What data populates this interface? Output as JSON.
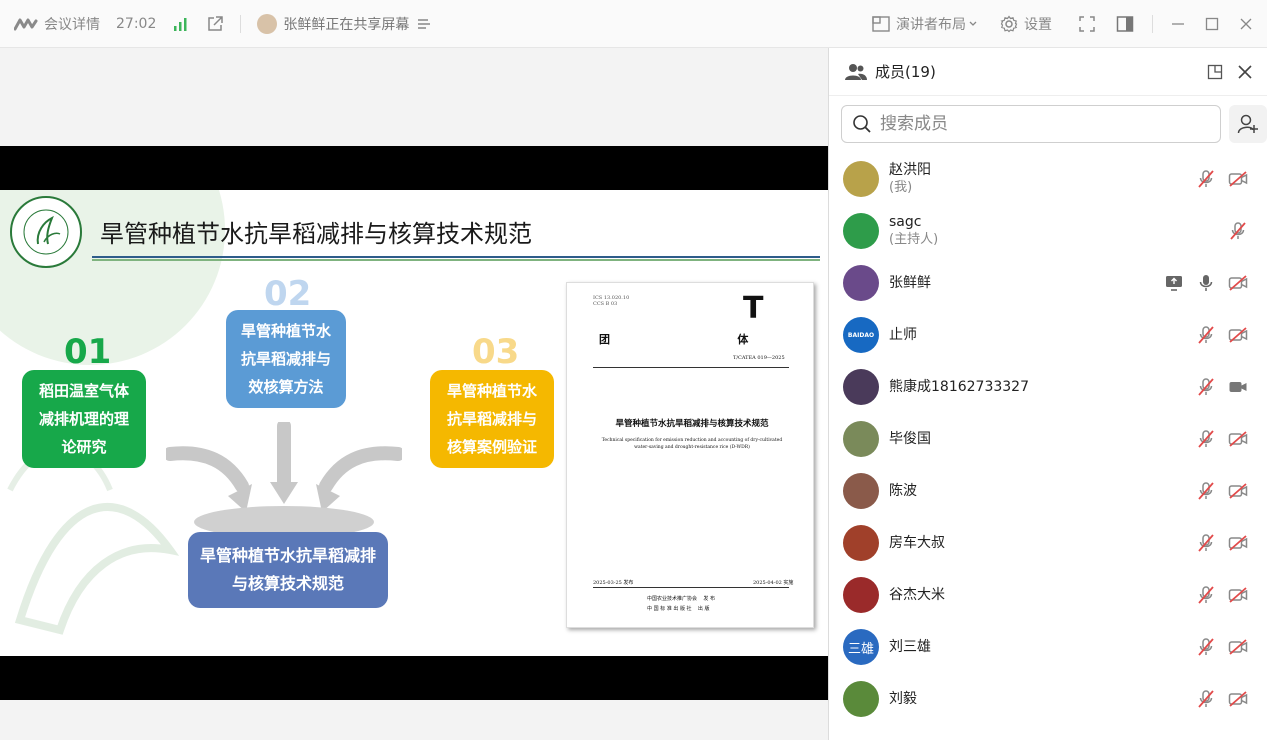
{
  "topbar": {
    "meeting_details": "会议详情",
    "timer": "27:02",
    "sharing_text": "张鲜鲜正在共享屏幕",
    "layout_label": "演讲者布局",
    "settings_label": "设置"
  },
  "slide": {
    "title": "旱管种植节水抗旱稻减排与核算技术规范",
    "items": [
      {
        "num": "01",
        "text": "稻田温室气体减排机理的理论研究"
      },
      {
        "num": "02",
        "text": "旱管种植节水抗旱稻减排与效核算方法"
      },
      {
        "num": "03",
        "text": "旱管种植节水抗旱稻减排与核算案例验证"
      }
    ],
    "center_box": "旱管种植节水抗旱稻减排与核算技术规范",
    "document": {
      "code": "ICS 13.020.10\nCCS B 03",
      "letter": "T",
      "heading": "团    体    标    准",
      "std_no": "T/CATEA  019—2025",
      "title_cn": "旱管种植节水抗旱稻减排与核算技术规范",
      "title_en": "Technical specification for emission reduction and accounting of dry-cultivated water-saving and drought-resistance rice (D-WDR)",
      "issue_date": "2025-03-25 发布",
      "impl_date": "2025-04-02 实施",
      "publisher1": "中国农业技术推广协会    发 布",
      "publisher2": "中 国 标 准 出 版 社    出 版"
    }
  },
  "panel": {
    "title": "成员(19)",
    "search_placeholder": "搜索成员",
    "members": [
      {
        "name": "赵洪阳",
        "role": "(我)",
        "avatar_color": "#b8a24a",
        "avatar_text": "",
        "share": false,
        "mic": "muted",
        "cam": "off"
      },
      {
        "name": "sagc",
        "role": "(主持人)",
        "avatar_color": "#2e9c4a",
        "avatar_text": "",
        "share": false,
        "mic": "muted",
        "cam": "none"
      },
      {
        "name": "张鲜鲜",
        "role": "",
        "avatar_color": "#6a4a8a",
        "avatar_text": "",
        "share": true,
        "mic": "on",
        "cam": "off"
      },
      {
        "name": "止师",
        "role": "",
        "avatar_color": "#1769c2",
        "avatar_text": "BAIDAO",
        "share": false,
        "mic": "muted",
        "cam": "off"
      },
      {
        "name": "熊康成18162733327",
        "role": "",
        "avatar_color": "#4a3a5a",
        "avatar_text": "",
        "share": false,
        "mic": "muted",
        "cam": "on"
      },
      {
        "name": "毕俊国",
        "role": "",
        "avatar_color": "#7a8a5a",
        "avatar_text": "",
        "share": false,
        "mic": "muted",
        "cam": "off"
      },
      {
        "name": "陈波",
        "role": "",
        "avatar_color": "#8a5a4a",
        "avatar_text": "",
        "share": false,
        "mic": "muted",
        "cam": "off"
      },
      {
        "name": "房车大叔",
        "role": "",
        "avatar_color": "#a0402a",
        "avatar_text": "",
        "share": false,
        "mic": "muted",
        "cam": "off"
      },
      {
        "name": "谷杰大米",
        "role": "",
        "avatar_color": "#9a2a2a",
        "avatar_text": "",
        "share": false,
        "mic": "muted",
        "cam": "off"
      },
      {
        "name": "刘三雄",
        "role": "",
        "avatar_color": "#2a6ac0",
        "avatar_text": "三雄",
        "share": false,
        "mic": "muted",
        "cam": "off"
      },
      {
        "name": "刘毅",
        "role": "",
        "avatar_color": "#5a8a3a",
        "avatar_text": "",
        "share": false,
        "mic": "muted",
        "cam": "off"
      }
    ]
  },
  "colors": {
    "accent": "#2a7be4",
    "green_box": "#17a84a",
    "blue_box": "#5b9bd5",
    "yellow_box": "#f5b800",
    "navy_box": "#5a78b8",
    "muted_red": "#e24a4a"
  }
}
